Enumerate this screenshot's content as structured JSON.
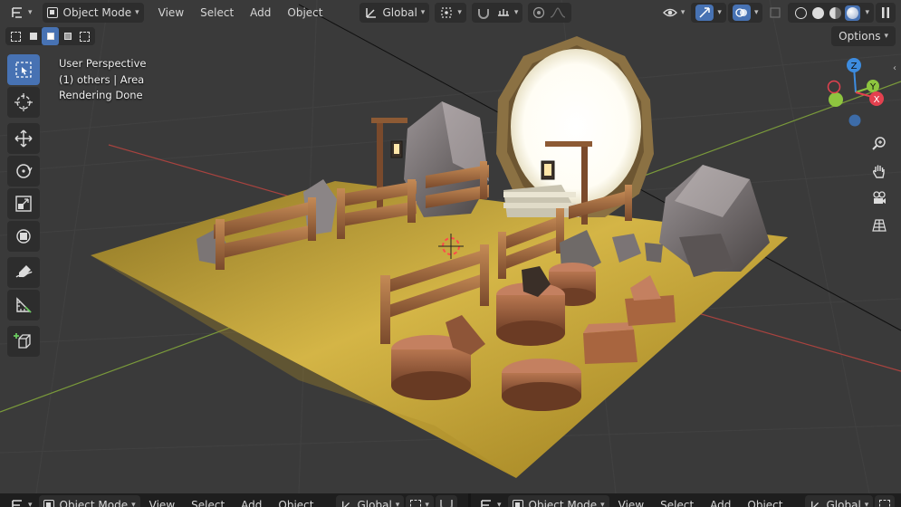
{
  "header": {
    "mode_label": "Object Mode",
    "menus": [
      "View",
      "Select",
      "Add",
      "Object"
    ],
    "transform_orientation": "Global",
    "options_label": "Options"
  },
  "overlay": {
    "line1": "User Perspective",
    "line2": "(1) others | Area",
    "line3": "Rendering Done"
  },
  "gizmo": {
    "x_label": "X",
    "y_label": "Y",
    "z_label": "Z"
  },
  "bottom": {
    "left": {
      "mode_label": "Object Mode",
      "menus": [
        "View",
        "Select",
        "Add",
        "Object"
      ],
      "transform_orientation": "Global"
    },
    "right": {
      "mode_label": "Object Mode",
      "menus": [
        "View",
        "Select",
        "Add",
        "Object"
      ],
      "transform_orientation": "Global"
    }
  },
  "colors": {
    "accent": "#4772b3",
    "axis_x": "#e4414f",
    "axis_y": "#8ec53f",
    "axis_z": "#3d8ce0",
    "ground": "#c4a134"
  }
}
